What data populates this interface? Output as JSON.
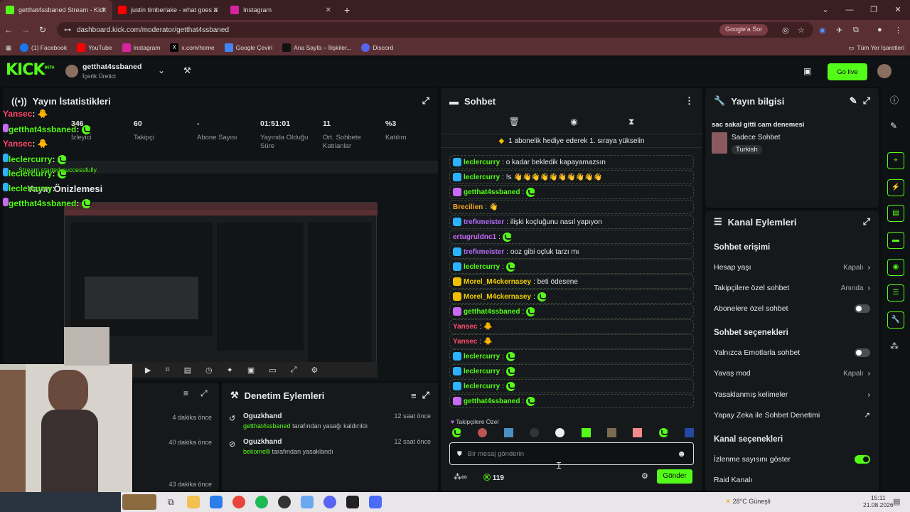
{
  "browser": {
    "tabs": [
      {
        "label": "getthat4ssbaned Stream - Kick",
        "color": "#53fc18"
      },
      {
        "label": "justin timberlake - what goes a",
        "color": "#ff0000"
      },
      {
        "label": "Instagram",
        "color": "#d6249f"
      }
    ],
    "new_tab": "+",
    "url": "dashboard.kick.com/moderator/getthat4ssbaned",
    "google_sor": "Google'a Sor",
    "bookmarks": [
      "(1) Facebook",
      "YouTube",
      "Instagram",
      "x.com/home",
      "Google Çeviri",
      "Ana Sayfa – İlişkiler...",
      "Discord"
    ],
    "bookmarks_right": "Tüm Yer İşaretleri"
  },
  "header": {
    "logo": "KICK",
    "logo_beta": "BETA",
    "channel_name": "getthat4ssbaned",
    "channel_role": "İçerik Üretici",
    "go_live": "Go live"
  },
  "stats": {
    "title": "Yayın İstatistikleri",
    "items": [
      {
        "value": "346",
        "label": "İzleyici"
      },
      {
        "value": "60",
        "label": "Takipçi"
      },
      {
        "value": "-",
        "label": "Abone Sayısı"
      },
      {
        "value": "01:51:01",
        "label": "Yayında Olduğu Süre"
      },
      {
        "value": "11",
        "label": "Ort. Sohbete Katılanlar"
      },
      {
        "value": "%3",
        "label": "Katılım"
      }
    ],
    "preview_title": "Yayın Önizlemesi"
  },
  "overlay": {
    "lines": [
      {
        "user": "Yansec",
        "text": ":"
      },
      {
        "user": "getthat4ssbaned",
        "text": ":"
      },
      {
        "user": "Yansec",
        "text": ":"
      },
      {
        "user": "leclercurry",
        "text": ":"
      },
      {
        "user": "leclercurry",
        "text": ":"
      },
      {
        "user": "leclercurry",
        "text": ":"
      },
      {
        "user": "getthat4ssbaned",
        "text": ":"
      }
    ],
    "success": "Stream started successfully."
  },
  "mod_actions": {
    "title": "Denetim Eylemleri",
    "items": [
      {
        "actor": "Oguzkhand",
        "target": "getthat4ssbaned",
        "action": "tarafından yasağı kaldırıldı",
        "time": "12 saat önce"
      },
      {
        "actor": "Oguzkhand",
        "target": "bekomelli",
        "action": "tarafından yasaklandı",
        "time": "12 saat önce"
      }
    ],
    "left_times": [
      "4 dakika önce",
      "40 dakika önce",
      "43 dakika önce"
    ]
  },
  "chat": {
    "title": "Sohbet",
    "pinned": "1 abonelik hediye ederek 1. sıraya yükselin",
    "messages": [
      {
        "user": "leclercurry",
        "color": "#53fc18",
        "text": ": o kadar bekledik kapayamazsın"
      },
      {
        "user": "leclercurry",
        "color": "#53fc18",
        "text": ": !s"
      },
      {
        "user": "getthat4ssbaned",
        "color": "#53fc18",
        "text": ":"
      },
      {
        "user": "Brecilien",
        "color": "#f5a623",
        "text": ":"
      },
      {
        "user": "trefkmeister",
        "color": "#b06af5",
        "text": ": ilişki koçluğunu nasıl yapıyon"
      },
      {
        "user": "ertugruldnc1",
        "color": "#c86af5",
        "text": ":"
      },
      {
        "user": "trefkmeister",
        "color": "#b06af5",
        "text": ": ooz gibi oçluk tarzı mı"
      },
      {
        "user": "leclercurry",
        "color": "#53fc18",
        "text": ":"
      },
      {
        "user": "Morel_M4ckernasey",
        "color": "#f0d000",
        "text": ": beti ödesene"
      },
      {
        "user": "Morel_M4ckernasey",
        "color": "#f0d000",
        "text": ":"
      },
      {
        "user": "getthat4ssbaned",
        "color": "#53fc18",
        "text": ":"
      },
      {
        "user": "Yansec",
        "color": "#ff4b6e",
        "text": ":"
      },
      {
        "user": "Yansec",
        "color": "#ff4b6e",
        "text": ":"
      },
      {
        "user": "leclercurry",
        "color": "#53fc18",
        "text": ":"
      },
      {
        "user": "leclercurry",
        "color": "#53fc18",
        "text": ":"
      },
      {
        "user": "leclercurry",
        "color": "#53fc18",
        "text": ":"
      },
      {
        "user": "getthat4ssbaned",
        "color": "#53fc18",
        "text": ":"
      }
    ],
    "followers_only": "Takipçilere Özel",
    "input_placeholder": "Bir mesaj gönderin",
    "points": "119",
    "send": "Gönder"
  },
  "stream_info": {
    "title": "Yayın bilgisi",
    "stream_title": "sac sakal gitti cam denemesi",
    "category": "Sadece Sohbet",
    "language": "Turkish"
  },
  "channel_actions": {
    "title": "Kanal Eylemleri",
    "chat_access": "Sohbet erişimi",
    "account_age": {
      "label": "Hesap yaşı",
      "value": "Kapalı"
    },
    "followers_chat": {
      "label": "Takipçilere özel sohbet",
      "value": "Anında"
    },
    "subs_chat": {
      "label": "Abonelere özel sohbet"
    },
    "chat_options": "Sohbet seçenekleri",
    "emote_only": {
      "label": "Yalnızca Emotlarla sohbet"
    },
    "slow_mode": {
      "label": "Yavaş mod",
      "value": "Kapalı"
    },
    "banned_words": {
      "label": "Yasaklanmış kelimeler"
    },
    "ai_moderation": {
      "label": "Yapay Zeka ile Sohbet Denetimi"
    },
    "channel_options": "Kanal seçenekleri",
    "show_viewers": {
      "label": "İzlenme sayısını göster"
    },
    "raid": {
      "label": "Raid Kanalı"
    }
  },
  "taskbar": {
    "weather": "28°C  Güneşli",
    "time": "15:11",
    "date": "21.08.2026"
  },
  "colors": {
    "accent": "#53fc18",
    "bg": "#0b0e0f",
    "panel": "#16191b"
  }
}
